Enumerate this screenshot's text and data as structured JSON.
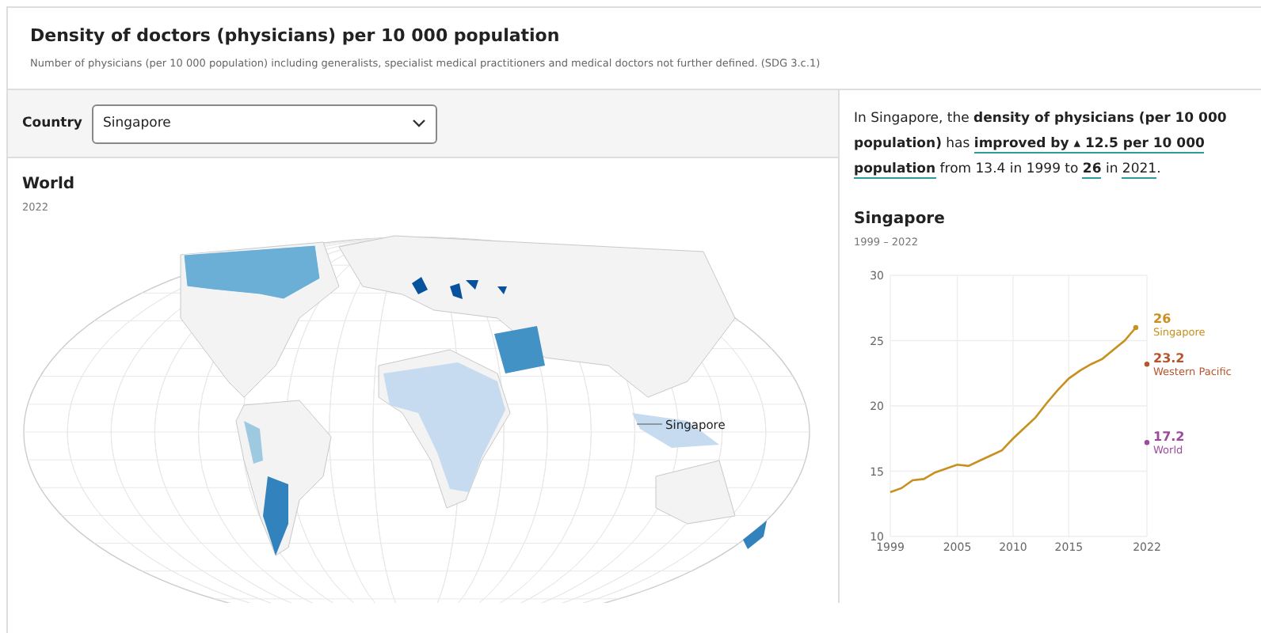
{
  "header": {
    "title": "Density of doctors (physicians) per 10 000 population",
    "subtitle": "Number of physicians (per 10 000 population) including generalists, specialist medical practitioners and medical doctors not further defined. (SDG 3.c.1)"
  },
  "country_filter": {
    "label": "Country",
    "value": "Singapore"
  },
  "map": {
    "title": "World",
    "year": "2022",
    "highlight_label": "Singapore"
  },
  "summary": {
    "segments": [
      {
        "text": "In Singapore, the ",
        "bold": false,
        "underlined": false
      },
      {
        "text": "density of physicians (per 10 000 population)",
        "bold": true,
        "underlined": false
      },
      {
        "text": " has ",
        "bold": false,
        "underlined": false
      },
      {
        "text": "improved by ▴ 12.5 per 10 000 population",
        "bold": true,
        "underlined": true
      },
      {
        "text": " from 13.4 in 1999 to ",
        "bold": false,
        "underlined": false
      },
      {
        "text": "26",
        "bold": true,
        "underlined": true
      },
      {
        "text": " in ",
        "bold": false,
        "underlined": false
      },
      {
        "text": "2021",
        "bold": false,
        "underlined": true
      },
      {
        "text": ".",
        "bold": false,
        "underlined": false
      }
    ]
  },
  "trend": {
    "title": "Singapore",
    "period": "1999 – 2022",
    "chart_data": {
      "type": "line",
      "x": [
        1999,
        2000,
        2001,
        2002,
        2003,
        2004,
        2005,
        2006,
        2007,
        2008,
        2009,
        2010,
        2011,
        2012,
        2013,
        2014,
        2015,
        2016,
        2017,
        2018,
        2019,
        2020,
        2021,
        2022
      ],
      "grid": true,
      "xlim": [
        1999,
        2022
      ],
      "ylim": [
        10,
        30
      ],
      "xticks": [
        1999,
        2005,
        2010,
        2015,
        2022
      ],
      "yticks": [
        10,
        15,
        20,
        25,
        30
      ],
      "series": [
        {
          "name": "Singapore",
          "color": "#c8901e",
          "values": [
            13.4,
            13.7,
            14.3,
            14.4,
            14.9,
            15.2,
            15.5,
            15.4,
            15.8,
            16.2,
            16.6,
            17.5,
            18.3,
            19.1,
            20.2,
            21.2,
            22.1,
            22.7,
            23.2,
            23.6,
            24.3,
            25.0,
            26,
            null
          ]
        },
        {
          "name": "Western Pacific",
          "color": "#b5552e",
          "marker": "circle",
          "values": [
            null,
            null,
            null,
            null,
            null,
            null,
            null,
            null,
            null,
            null,
            null,
            null,
            null,
            null,
            null,
            null,
            null,
            null,
            null,
            null,
            null,
            null,
            null,
            23.2
          ]
        },
        {
          "name": "World",
          "color": "#9c4a9e",
          "marker": "circle",
          "values": [
            null,
            null,
            null,
            null,
            null,
            null,
            null,
            null,
            null,
            null,
            null,
            null,
            null,
            null,
            null,
            null,
            null,
            null,
            null,
            null,
            null,
            null,
            null,
            17.2
          ]
        }
      ],
      "value_labels": [
        "26",
        "23.2",
        "17.2"
      ]
    }
  }
}
